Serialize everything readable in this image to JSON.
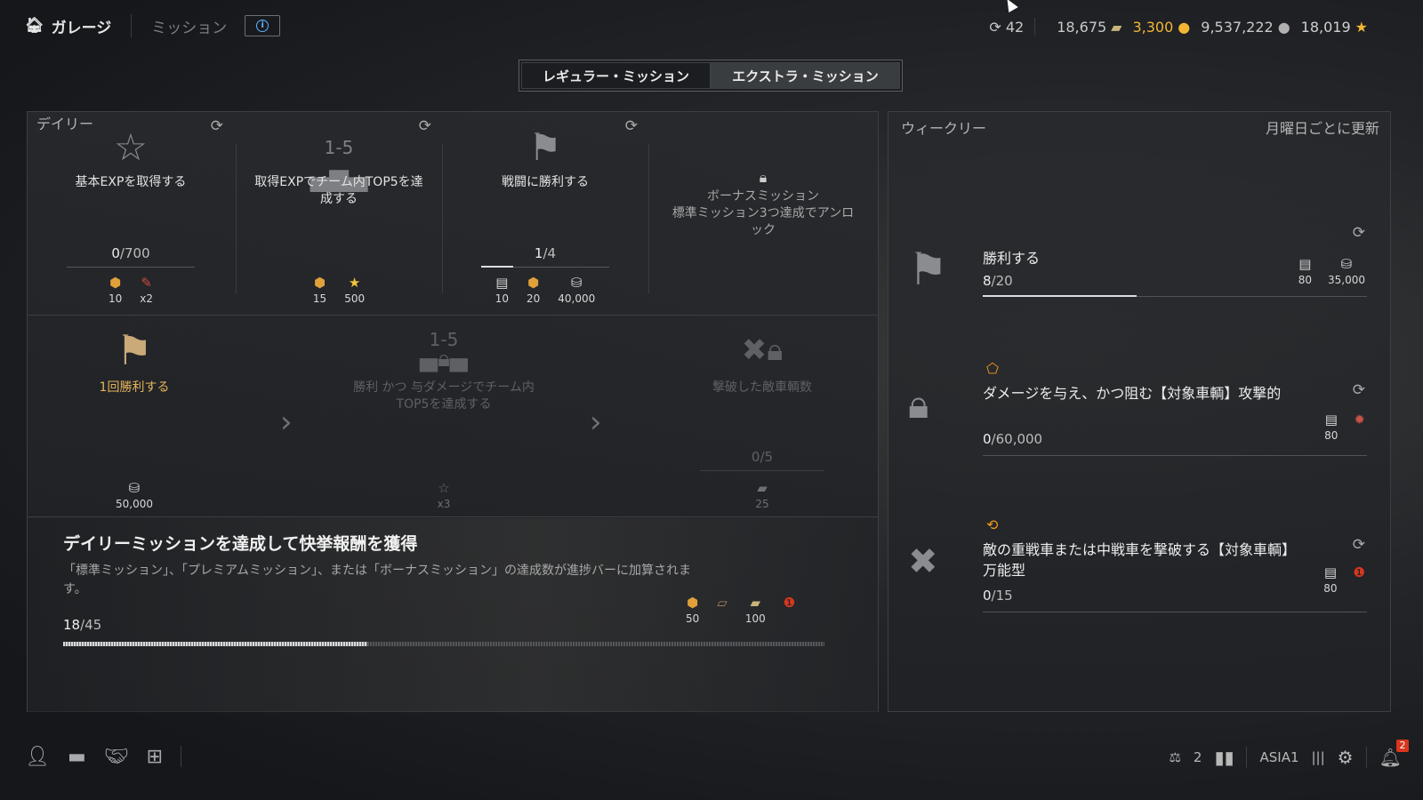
{
  "header": {
    "garage_label": "ガレージ",
    "missions_label": "ミッション",
    "info_icon": "info-icon",
    "currencies": {
      "premium_days": "42",
      "bonds": "18,675",
      "gold": "3,300",
      "credits": "9,537,222",
      "free_xp": "18,019"
    }
  },
  "tabs": [
    {
      "label": "レギュラー・ミッション",
      "active": false
    },
    {
      "label": "エクストラ・ミッション",
      "active": true
    }
  ],
  "daily": {
    "label": "デイリー",
    "cards": [
      {
        "title": "基本EXPを取得する",
        "progress_current": "0",
        "progress_total": "/700",
        "progress_fraction": 0.0,
        "rewards": [
          {
            "icon": "booster-icon",
            "value": "10"
          },
          {
            "icon": "camo-icon",
            "value": "x2"
          }
        ]
      },
      {
        "title": "取得EXPでチーム内TOP5を達成する",
        "icon_text": "1-5",
        "progress_current": "",
        "progress_total": "",
        "progress_fraction": 0.0,
        "rewards": [
          {
            "icon": "booster-icon",
            "value": "15"
          },
          {
            "icon": "star-icon",
            "value": "500"
          }
        ]
      },
      {
        "title": "戦闘に勝利する",
        "progress_current": "1",
        "progress_total": "/4",
        "progress_fraction": 0.25,
        "rewards": [
          {
            "icon": "token-icon",
            "value": "10"
          },
          {
            "icon": "booster-icon",
            "value": "20"
          },
          {
            "icon": "credits-icon",
            "value": "40,000"
          }
        ]
      },
      {
        "title": "ボーナスミッション\n標準ミッション3つ達成でアンロック"
      }
    ],
    "chain": [
      {
        "title": "1回勝利する",
        "reward_value": "50,000"
      },
      {
        "title": "勝利 かつ 与ダメージでチーム内TOP5を達成する",
        "icon_text": "1-5",
        "reward_value": "x3"
      },
      {
        "title": "撃破した敵車輌数",
        "progress": "0/5",
        "reward_value": "25"
      }
    ],
    "promo": {
      "title": "デイリーミッションを達成して快挙報酬を獲得",
      "desc": "「標準ミッション」、「プレミアムミッション」、または「ボーナスミッション」の達成数が進捗バーに加算されます。",
      "progress_current": "18",
      "progress_total": "/45",
      "progress_fraction": 0.4,
      "rewards": [
        {
          "icon": "booster-icon",
          "value": "50"
        },
        {
          "icon": "blueprint-icon",
          "value": ""
        },
        {
          "icon": "bond-icon",
          "value": "100"
        },
        {
          "icon": "medal-icon",
          "value": ""
        }
      ]
    }
  },
  "weekly": {
    "label": "ウィークリー",
    "note": "月曜日ごとに更新",
    "items": [
      {
        "title": "勝利する",
        "progress_current": "8",
        "progress_total": "/20",
        "progress_fraction": 0.4,
        "rewards": [
          {
            "icon": "token-icon",
            "value": "80"
          },
          {
            "icon": "credits-icon",
            "value": "35,000"
          }
        ]
      },
      {
        "title": "ダメージを与え、かつ阻む【対象車輌】攻撃的",
        "progress_current": "0",
        "progress_total": "/60,000",
        "progress_fraction": 0.0,
        "rewards": [
          {
            "icon": "token-icon",
            "value": "80"
          },
          {
            "icon": "decal-icon",
            "value": ""
          }
        ]
      },
      {
        "title": "敵の重戦車または中戦車を撃破する【対象車輌】万能型",
        "progress_current": "0",
        "progress_total": "/15",
        "progress_fraction": 0.0,
        "rewards": [
          {
            "icon": "token-icon",
            "value": "80"
          },
          {
            "icon": "medal-icon",
            "value": ""
          }
        ]
      }
    ]
  },
  "footer": {
    "battles": "2",
    "server": "ASIA1",
    "notifications": "2"
  },
  "colors": {
    "gold": "#f2b632",
    "accent_orange": "#f29a18"
  }
}
